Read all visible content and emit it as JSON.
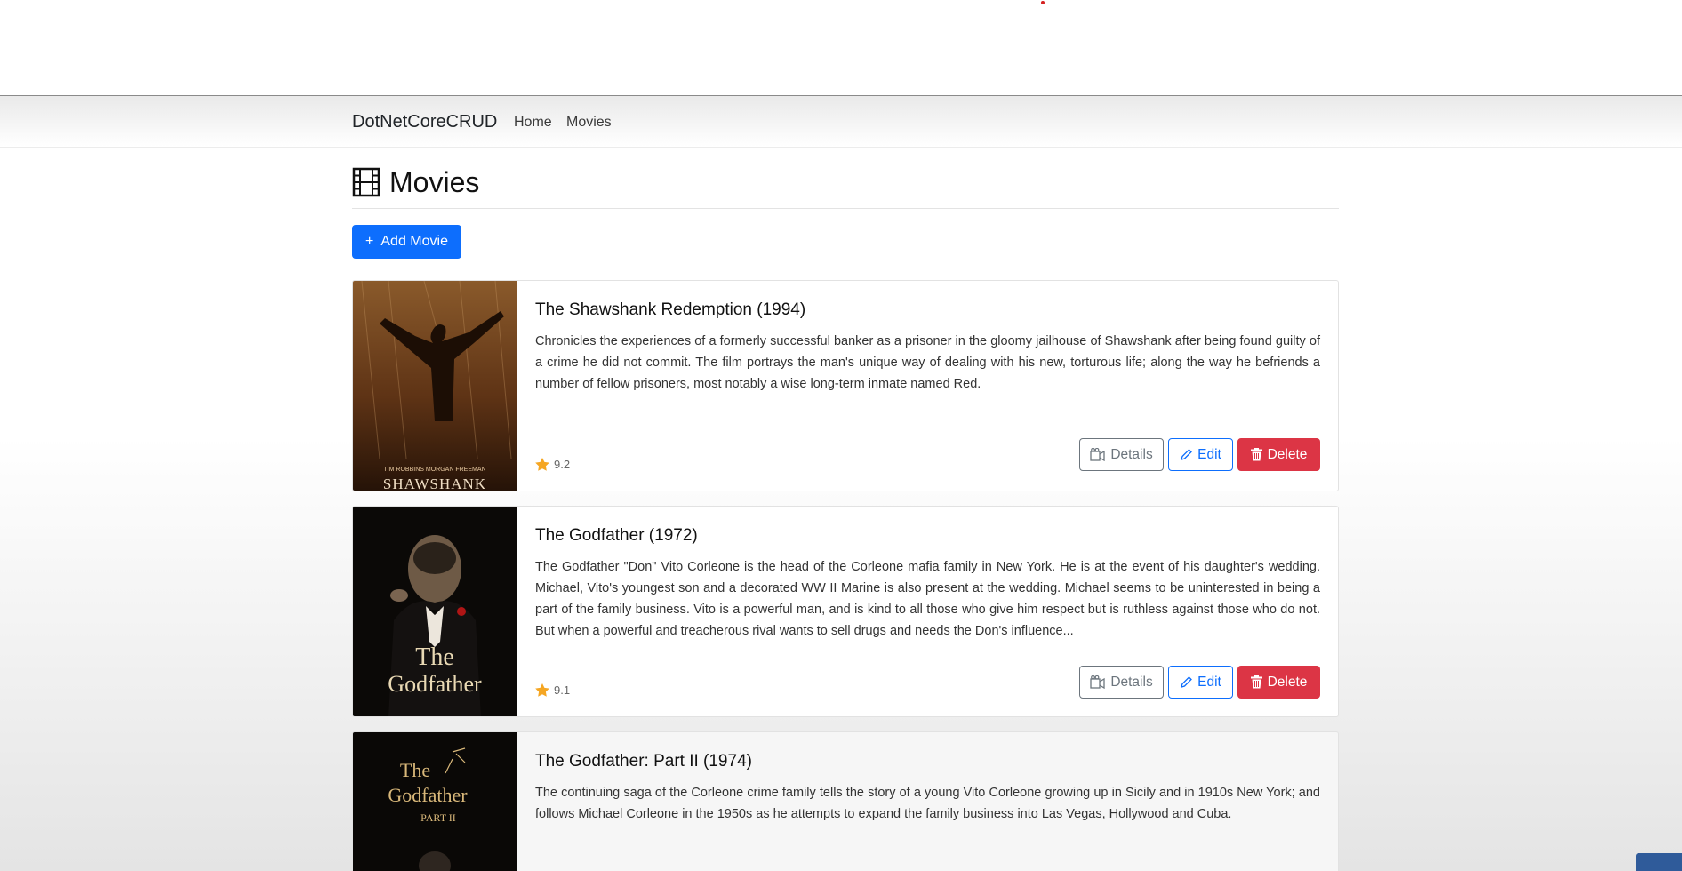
{
  "navbar": {
    "brand": "DotNetCoreCRUD",
    "links": [
      "Home",
      "Movies"
    ]
  },
  "page": {
    "title": "Movies",
    "title_icon": "film-icon",
    "add_button_label": "Add Movie",
    "add_button_icon": "plus-icon"
  },
  "movies": [
    {
      "title": "The Shawshank Redemption (1994)",
      "description": "Chronicles the experiences of a formerly successful banker as a prisoner in the gloomy jailhouse of Shawshank after being found guilty of a crime he did not commit. The film portrays the man's unique way of dealing with his new, torturous life; along the way he befriends a number of fellow prisoners, most notably a wise long-term inmate named Red.",
      "rating": "9.2",
      "poster": {
        "credits": "TIM ROBBINS   MORGAN FREEMAN",
        "caption": "SHAWSHANK"
      }
    },
    {
      "title": "The Godfather (1972)",
      "description": "The Godfather \"Don\" Vito Corleone is the head of the Corleone mafia family in New York. He is at the event of his daughter's wedding. Michael, Vito's youngest son and a decorated WW II Marine is also present at the wedding. Michael seems to be uninterested in being a part of the family business. Vito is a powerful man, and is kind to all those who give him respect but is ruthless against those who do not. But when a powerful and treacherous rival wants to sell drugs and needs the Don's influence...",
      "rating": "9.1",
      "poster": {
        "caption_line1": "The",
        "caption_line2": "Godfather"
      }
    },
    {
      "title": "The Godfather: Part II (1974)",
      "description": "The continuing saga of the Corleone crime family tells the story of a young Vito Corleone growing up in Sicily and in 1910s New York; and follows Michael Corleone in the 1950s as he attempts to expand the family business into Las Vegas, Hollywood and Cuba.",
      "poster": {
        "caption_line1": "The",
        "caption_line2": "Godfather",
        "caption_line3": "PART II"
      }
    }
  ],
  "actions": {
    "details_label": "Details",
    "edit_label": "Edit",
    "delete_label": "Delete"
  },
  "colors": {
    "primary": "#0d6efd",
    "danger": "#dc3545",
    "secondary": "#6c757d",
    "star": "#f5a623"
  }
}
